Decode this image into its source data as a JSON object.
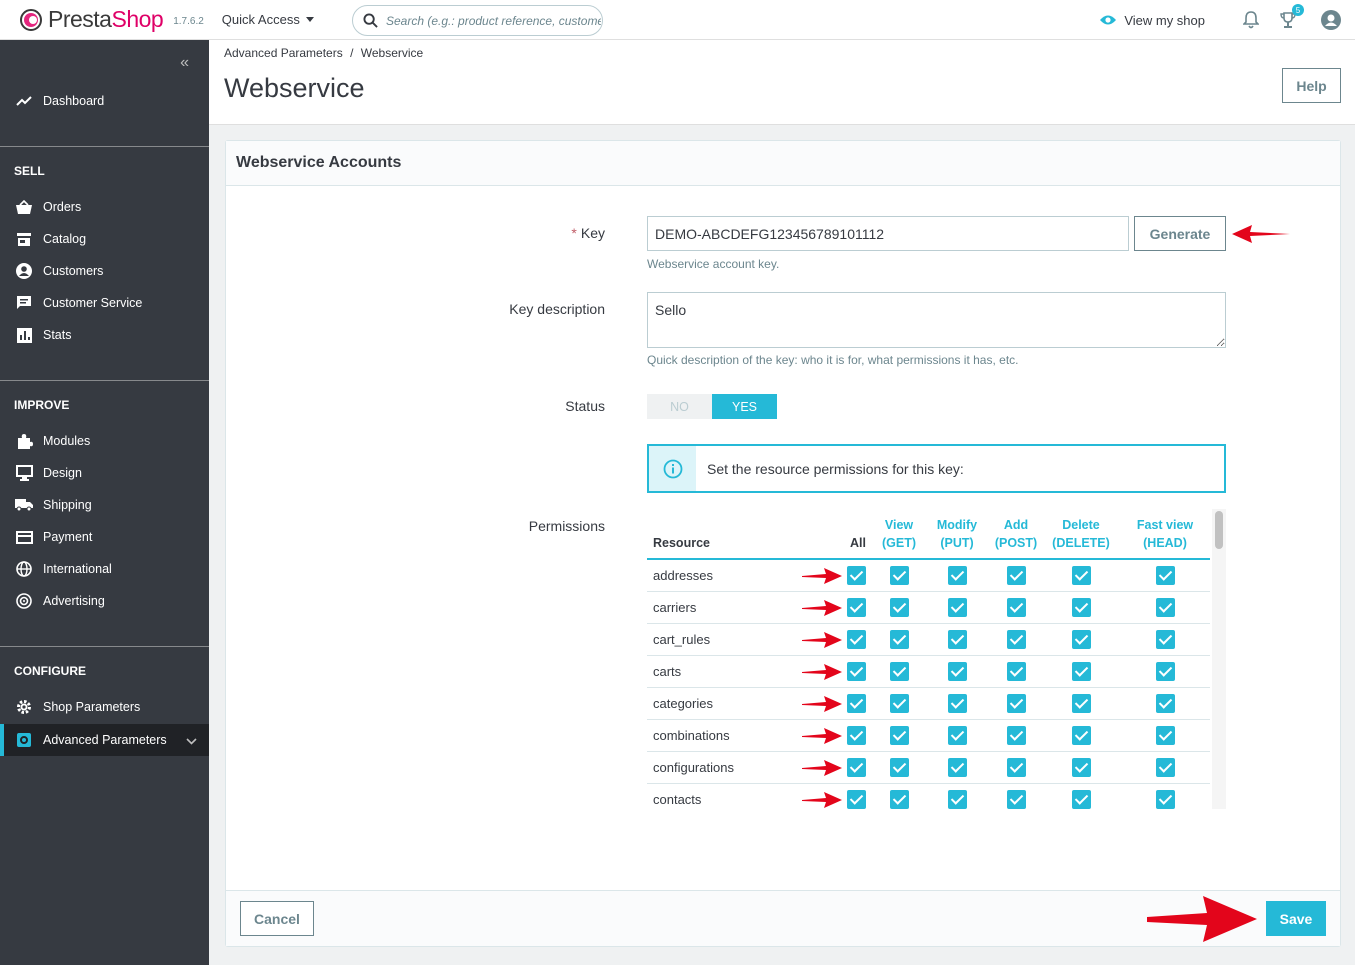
{
  "header": {
    "logo_prefix": "Presta",
    "logo_suffix": "Shop",
    "version": "1.7.6.2",
    "quick_access": "Quick Access",
    "search_placeholder": "Search (e.g.: product reference, customer name…)",
    "view_shop": "View my shop",
    "notification_count": "5"
  },
  "sidebar": {
    "dashboard": "Dashboard",
    "sections": [
      {
        "title": "SELL",
        "items": [
          "Orders",
          "Catalog",
          "Customers",
          "Customer Service",
          "Stats"
        ]
      },
      {
        "title": "IMPROVE",
        "items": [
          "Modules",
          "Design",
          "Shipping",
          "Payment",
          "International",
          "Advertising"
        ]
      },
      {
        "title": "CONFIGURE",
        "items": [
          "Shop Parameters",
          "Advanced Parameters"
        ]
      }
    ],
    "active": "Advanced Parameters"
  },
  "page": {
    "breadcrumb_parent": "Advanced Parameters",
    "breadcrumb_sep": "/",
    "breadcrumb_current": "Webservice",
    "title": "Webservice",
    "help": "Help"
  },
  "form": {
    "card_title": "Webservice Accounts",
    "key_label": "Key",
    "key_value": "DEMO-ABCDEFG123456789101112",
    "generate": "Generate",
    "key_hint": "Webservice account key.",
    "desc_label": "Key description",
    "desc_value": "Sello",
    "desc_hint": "Quick description of the key: who it is for, what permissions it has, etc.",
    "status_label": "Status",
    "status_no": "NO",
    "status_yes": "YES",
    "status_value": "YES",
    "alert": "Set the resource permissions for this key:",
    "permissions_label": "Permissions",
    "columns": {
      "resource": "Resource",
      "all": "All",
      "view": [
        "View",
        "(GET)"
      ],
      "modify": [
        "Modify",
        "(PUT)"
      ],
      "add": [
        "Add",
        "(POST)"
      ],
      "delete": [
        "Delete",
        "(DELETE)"
      ],
      "fast": [
        "Fast view",
        "(HEAD)"
      ]
    },
    "resources": [
      "addresses",
      "carriers",
      "cart_rules",
      "carts",
      "categories",
      "combinations",
      "configurations",
      "contacts"
    ],
    "cancel": "Cancel",
    "save": "Save"
  },
  "colors": {
    "accent": "#25b9d7",
    "sidebar": "#363a41",
    "annotation_arrow": "#e3051b"
  }
}
